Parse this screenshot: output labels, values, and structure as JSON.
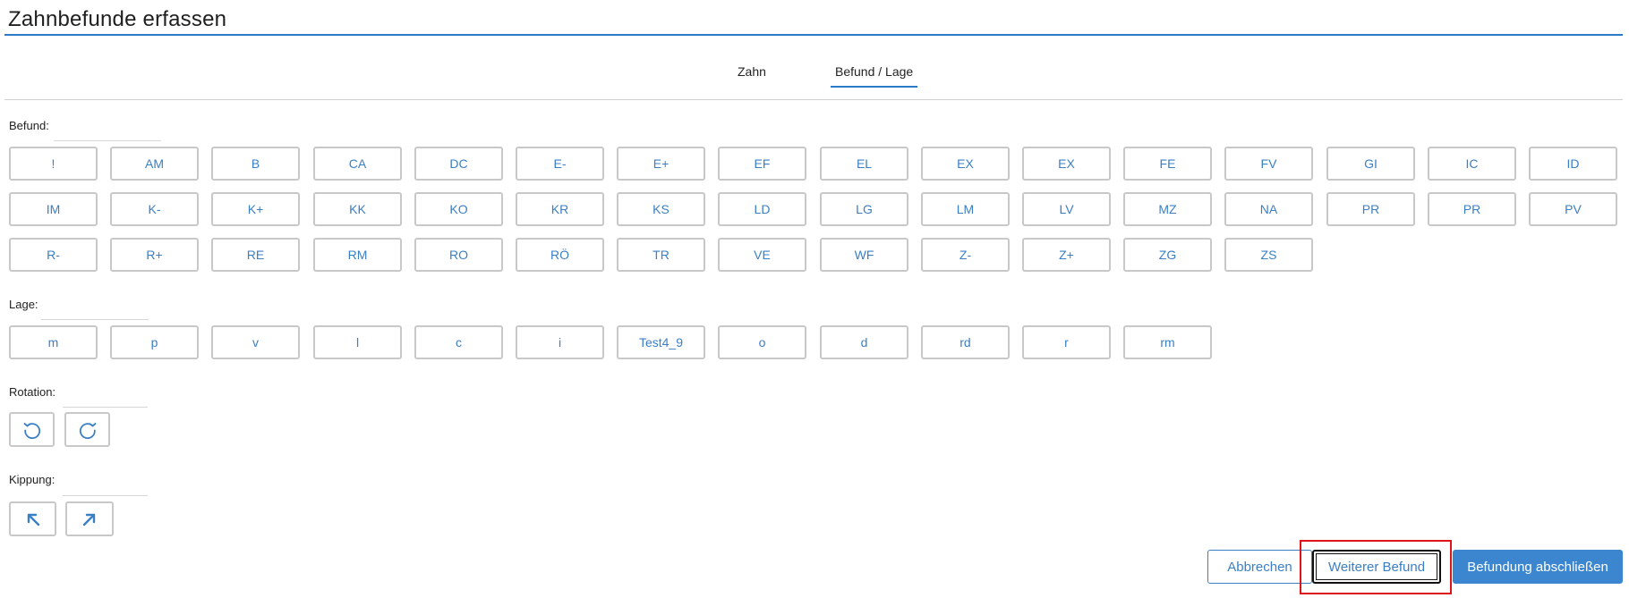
{
  "title": "Zahnbefunde erfassen",
  "tabs": {
    "zahn": "Zahn",
    "befund_lage": "Befund / Lage"
  },
  "befund": {
    "label": "Befund:",
    "rows": [
      [
        "!",
        "AM",
        "B",
        "CA",
        "DC",
        "E-",
        "E+",
        "EF",
        "EL",
        "EX",
        "EX",
        "FE",
        "FV",
        "GI",
        "IC",
        "ID"
      ],
      [
        "IM",
        "K-",
        "K+",
        "KK",
        "KO",
        "KR",
        "KS",
        "LD",
        "LG",
        "LM",
        "LV",
        "MZ",
        "NA",
        "PR",
        "PR",
        "PV"
      ],
      [
        "R-",
        "R+",
        "RE",
        "RM",
        "RO",
        "RÖ",
        "TR",
        "VE",
        "WF",
        "Z-",
        "Z+",
        "ZG",
        "ZS"
      ]
    ]
  },
  "lage": {
    "label": "Lage:",
    "items": [
      "m",
      "p",
      "v",
      "l",
      "c",
      "i",
      "Test4_9",
      "o",
      "d",
      "rd",
      "r",
      "rm"
    ]
  },
  "rotation": {
    "label": "Rotation:",
    "icons": [
      "rotate-ccw-icon",
      "rotate-cw-icon"
    ]
  },
  "kippung": {
    "label": "Kippung:",
    "icons": [
      "arrow-up-left-icon",
      "arrow-up-right-icon"
    ]
  },
  "footer": {
    "cancel": "Abbrechen",
    "next": "Weiterer Befund",
    "finish": "Befundung abschließen"
  },
  "colors": {
    "accent": "#3b86cf",
    "highlight": "#e0131b"
  }
}
